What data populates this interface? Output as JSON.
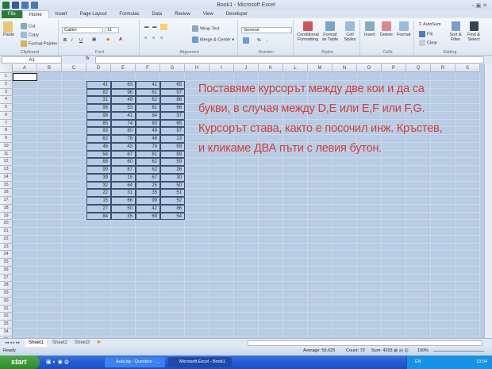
{
  "window": {
    "title": "Book1 - Microsoft Excel"
  },
  "ribbon_tabs": [
    "File",
    "Home",
    "Insert",
    "Page Layout",
    "Formulas",
    "Data",
    "Review",
    "View",
    "Developer"
  ],
  "clipboard": {
    "paste": "Paste",
    "cut": "Cut",
    "copy": "Copy",
    "format_painter": "Format Painter",
    "label": "Clipboard"
  },
  "font": {
    "name": "Calibri",
    "size": "11",
    "label": "Font",
    "bold": "B",
    "italic": "I",
    "underline": "U"
  },
  "alignment": {
    "wrap": "Wrap Text",
    "merge": "Merge & Center",
    "label": "Alignment"
  },
  "number": {
    "format": "General",
    "percent": "%",
    "comma": ",",
    "label": "Number"
  },
  "styles": {
    "conditional": "Conditional Formatting",
    "as_table": "Format as Table",
    "cell_styles": "Cell Styles",
    "label": "Styles"
  },
  "cells": {
    "insert": "Insert",
    "delete": "Delete",
    "format": "Format",
    "label": "Cells"
  },
  "editing": {
    "autosum": "AutoSum",
    "fill": "Fill",
    "clear": "Clear",
    "sort": "Sort & Filter",
    "find": "Find & Select",
    "label": "Editing"
  },
  "formula_bar": {
    "name_box": "A1",
    "fx": "fx",
    "value": ""
  },
  "columns": [
    "A",
    "B",
    "C",
    "D",
    "E",
    "F",
    "G",
    "H",
    "I",
    "J",
    "K",
    "L",
    "M",
    "N",
    "O",
    "P",
    "Q",
    "R",
    "S"
  ],
  "row_count": 35,
  "table": [
    [
      41,
      63,
      41,
      65
    ],
    [
      82,
      96,
      61,
      97
    ],
    [
      31,
      49,
      62,
      86
    ],
    [
      96,
      53,
      61,
      66
    ],
    [
      98,
      41,
      84,
      37
    ],
    [
      85,
      74,
      83,
      65
    ],
    [
      93,
      80,
      49,
      87
    ],
    [
      62,
      78,
      46,
      13
    ],
    [
      46,
      43,
      76,
      69
    ],
    [
      54,
      67,
      61,
      89
    ],
    [
      68,
      60,
      62,
      59
    ],
    [
      99,
      87,
      62,
      26
    ],
    [
      39,
      15,
      67,
      30
    ],
    [
      32,
      64,
      25,
      50
    ],
    [
      22,
      31,
      35,
      51
    ],
    [
      15,
      66,
      99,
      52
    ],
    [
      27,
      50,
      42,
      86
    ],
    [
      84,
      35,
      69,
      54
    ]
  ],
  "note": [
    "Поставяме курсорът между две кои и да са",
    "букви, в случая между  D,E или E,F или F,G.",
    "Курсорът става, както е посочил инж. Кръстев,",
    "и кликаме ДВА пъти с левия бутон."
  ],
  "sheets": [
    "Sheet1",
    "Sheet2",
    "Sheet3"
  ],
  "status": {
    "ready": "Ready",
    "average": "Average: 59,625",
    "count": "Count: 72",
    "sum": "Sum: 4293",
    "zoom": "100%"
  },
  "taskbar": {
    "start": "start",
    "items": [
      "Aula.bg - Question - ...",
      "Microsoft Excel - Book1"
    ],
    "lang": "EN",
    "time": "13:04"
  }
}
